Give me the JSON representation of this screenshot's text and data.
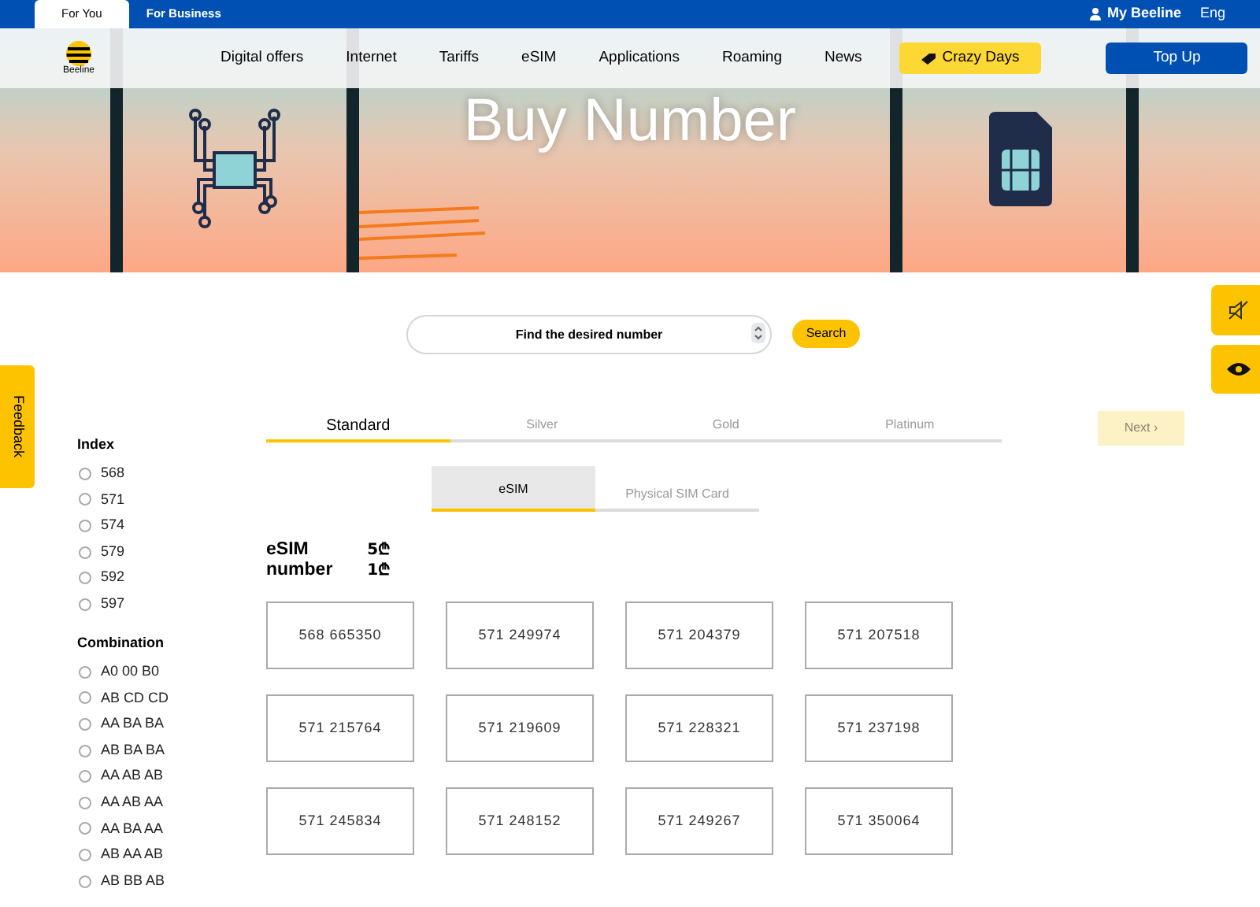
{
  "top_bar": {
    "segments": [
      {
        "label": "For You",
        "selected": true
      },
      {
        "label": "For Business",
        "selected": false
      }
    ],
    "account": "My Beeline",
    "language": "Eng"
  },
  "logo_text": "Вeeline",
  "nav": {
    "items": [
      "Digital offers",
      "Internet",
      "Tariffs",
      "eSIM",
      "Applications",
      "Roaming",
      "News"
    ],
    "promo": "Crazy Days",
    "top_up": "Top Up"
  },
  "hero": {
    "title": "Buy Number"
  },
  "search": {
    "placeholder": "Find the desired number",
    "button": "Search"
  },
  "feedback": "Feedback",
  "filters": [
    {
      "title": "Index",
      "options": [
        {
          "label": "568",
          "selected": false
        },
        {
          "label": "571",
          "selected": false
        },
        {
          "label": "574",
          "selected": false
        },
        {
          "label": "579",
          "selected": false
        },
        {
          "label": "592",
          "selected": false
        },
        {
          "label": "597",
          "selected": false
        }
      ]
    },
    {
      "title": "Combination",
      "options": [
        {
          "label": "A0 00 B0",
          "selected": false
        },
        {
          "label": "AB CD CD",
          "selected": false
        },
        {
          "label": "AA BA BA",
          "selected": false
        },
        {
          "label": "AB BA BA",
          "selected": false
        },
        {
          "label": "AA AB AB",
          "selected": false
        },
        {
          "label": "AA AB AA",
          "selected": false
        },
        {
          "label": "AA BA AA",
          "selected": false
        },
        {
          "label": "AB AA AB",
          "selected": false
        },
        {
          "label": "AB BB AB",
          "selected": false
        }
      ]
    }
  ],
  "tiers": [
    {
      "label": "Standard",
      "selected": true
    },
    {
      "label": "Silver",
      "selected": false
    },
    {
      "label": "Gold",
      "selected": false
    },
    {
      "label": "Platinum",
      "selected": false
    }
  ],
  "next_button": {
    "label": "Next ›",
    "disabled": true
  },
  "sim_tabs": [
    {
      "label": "eSIM",
      "selected": true
    },
    {
      "label": "Physical SIM Card",
      "selected": false
    }
  ],
  "price": {
    "labels": [
      "eSIM",
      "number"
    ],
    "values": [
      "5₾",
      "1₾"
    ]
  },
  "numbers": [
    "568 665350",
    "571 249974",
    "571 204379",
    "571 207518",
    "571 215764",
    "571 219609",
    "571 228321",
    "571 237198",
    "571 245834",
    "571 248152",
    "571 249267",
    "571 350064"
  ]
}
